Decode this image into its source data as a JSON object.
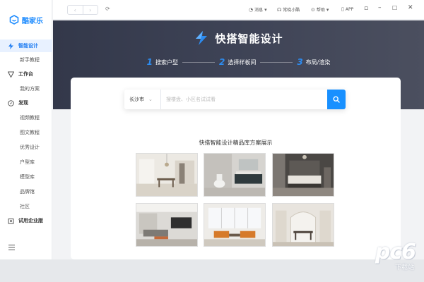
{
  "app": {
    "name": "酷家乐"
  },
  "sidebar": {
    "items": [
      {
        "label": "智能设计",
        "icon": "lightning-icon",
        "active": true
      },
      {
        "label": "新手教程"
      },
      {
        "label": "工作台",
        "icon": "workbench-icon"
      },
      {
        "label": "我的方案"
      },
      {
        "label": "发现",
        "icon": "discover-icon"
      },
      {
        "label": "视频教程"
      },
      {
        "label": "图文教程"
      },
      {
        "label": "优秀设计"
      },
      {
        "label": "户型库"
      },
      {
        "label": "模型库"
      },
      {
        "label": "品牌馆"
      },
      {
        "label": "社区"
      },
      {
        "label": "试用企业版",
        "icon": "enterprise-icon"
      }
    ]
  },
  "titlebar": {
    "back": "‹",
    "forward": "›",
    "messages": "消息",
    "assistant": "常晓小酷",
    "help": "帮助",
    "app": "APP"
  },
  "hero": {
    "title": "快搭智能设计",
    "steps": [
      {
        "num": "1",
        "label": "搜索户型"
      },
      {
        "num": "2",
        "label": "选择样板间"
      },
      {
        "num": "3",
        "label": "布局/渲染"
      }
    ]
  },
  "search": {
    "city": "长沙市",
    "placeholder": "搜楼盘、小区名试试看"
  },
  "gallery": {
    "title": "快搭智能设计精品库方案展示"
  },
  "watermark": {
    "main": "pc6",
    "sub": "下载站"
  },
  "colors": {
    "accent": "#1890ff",
    "hero_bg": "#383d50",
    "active_bg": "#e8f1ff"
  }
}
